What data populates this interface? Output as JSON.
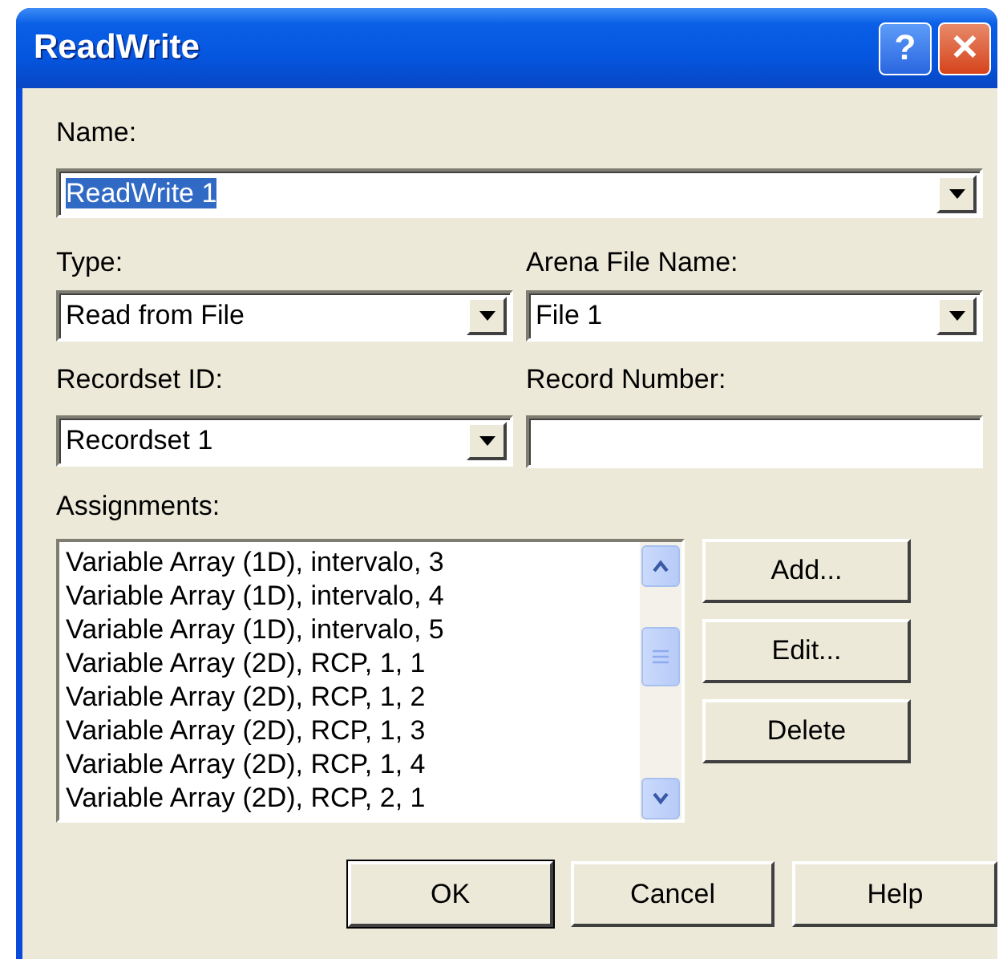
{
  "window": {
    "title": "ReadWrite",
    "title_buttons": [
      {
        "kind": "help",
        "label": "?"
      },
      {
        "kind": "close",
        "label": "✕"
      }
    ]
  },
  "name": {
    "label": "Name:",
    "value": "ReadWrite 1",
    "text_selected": true
  },
  "type": {
    "label": "Type:",
    "value": "Read from File"
  },
  "arena_file_name": {
    "label": "Arena File Name:",
    "value": "File 1"
  },
  "recordset_id": {
    "label": "Recordset ID:",
    "value": "Recordset 1"
  },
  "record_number": {
    "label": "Record Number:"
  },
  "assignments": {
    "label": "Assignments:",
    "items": [
      "Variable Array (1D), intervalo, 3",
      "Variable Array (1D), intervalo, 4",
      "Variable Array (1D), intervalo, 5",
      "Variable Array (2D), RCP, 1, 1",
      "Variable Array (2D), RCP, 1, 2",
      "Variable Array (2D), RCP, 1, 3",
      "Variable Array (2D), RCP, 1, 4",
      "Variable Array (2D), RCP, 2, 1"
    ],
    "buttons": [
      {
        "label": "Add..."
      },
      {
        "label": "Edit..."
      },
      {
        "label": "Delete"
      }
    ]
  },
  "buttons": [
    {
      "label": "OK",
      "default": true
    },
    {
      "label": "Cancel"
    },
    {
      "label": "Help"
    }
  ]
}
